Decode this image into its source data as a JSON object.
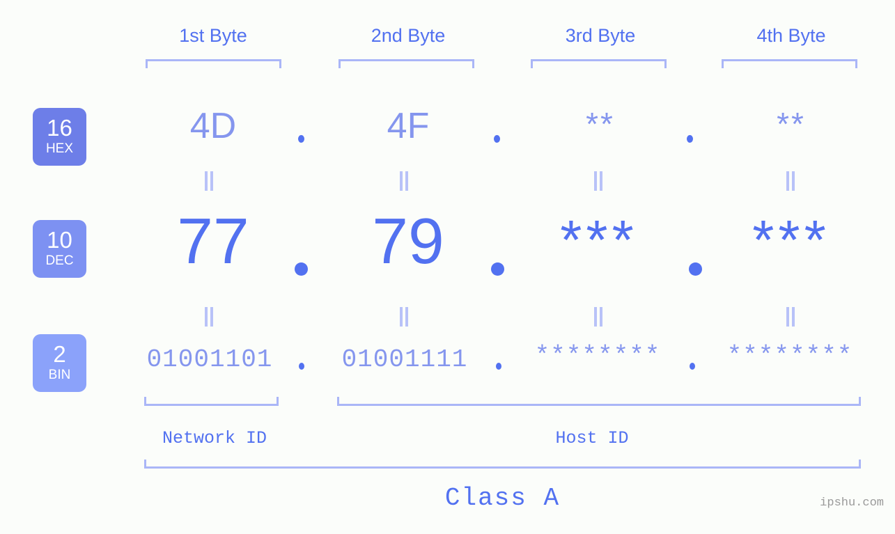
{
  "meta": {
    "watermark": "ipshu.com",
    "background_color": "#fbfdfa",
    "accent_color": "#5271f0",
    "accent_light_color": "#8596ee",
    "bracket_color": "#aab6f7"
  },
  "headers": [
    {
      "label": "1st Byte"
    },
    {
      "label": "2nd Byte"
    },
    {
      "label": "3rd Byte"
    },
    {
      "label": "4th Byte"
    }
  ],
  "rows": [
    {
      "base_number": "16",
      "base_name": "HEX",
      "badge_color": "#6d7ee8",
      "values": [
        "4D",
        "4F",
        "**",
        "**"
      ]
    },
    {
      "base_number": "10",
      "base_name": "DEC",
      "badge_color": "#7d91f2",
      "values": [
        "77",
        "79",
        "***",
        "***"
      ]
    },
    {
      "base_number": "2",
      "base_name": "BIN",
      "badge_color": "#8ba2fa",
      "values": [
        "01001101",
        "01001111",
        "********",
        "********"
      ]
    }
  ],
  "separators": {
    "hex_dot": ".",
    "dec_dot": ".",
    "bin_dot": "."
  },
  "equals_mark": "=",
  "footer": {
    "network_id_label": "Network ID",
    "host_id_label": "Host ID",
    "class_label": "Class A"
  }
}
